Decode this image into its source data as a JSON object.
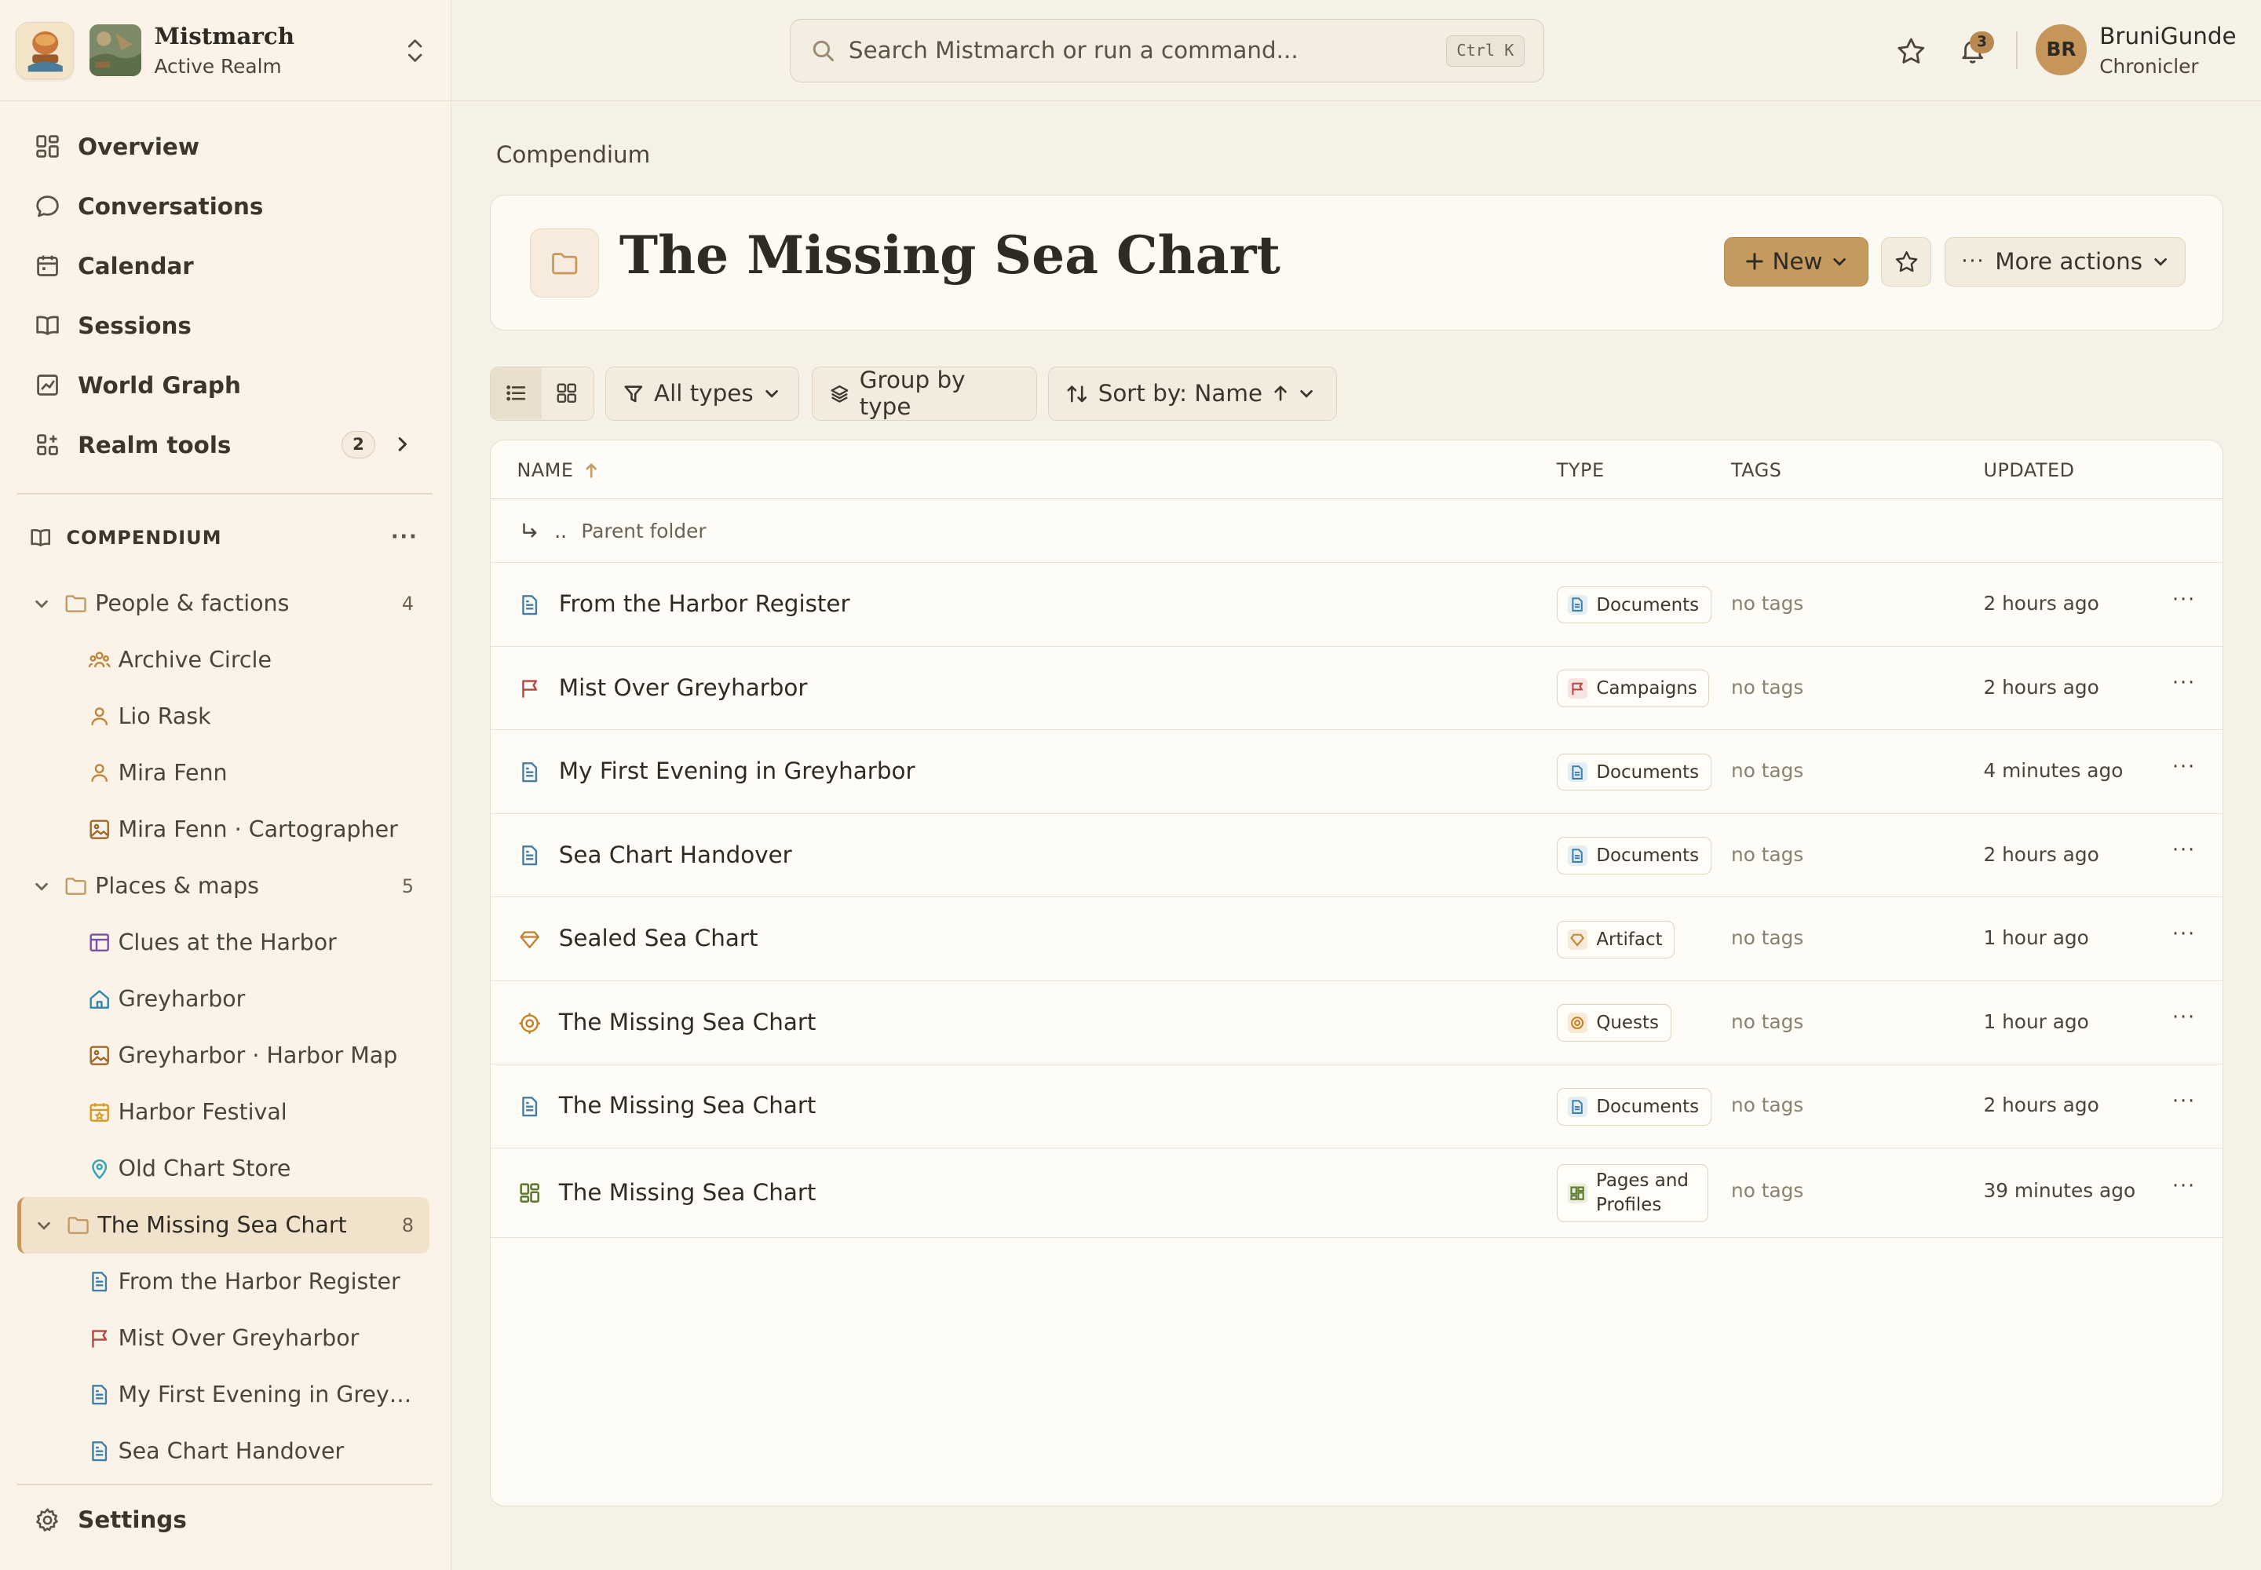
{
  "realm": {
    "name": "Mistmarch",
    "subtitle": "Active Realm"
  },
  "nav": {
    "overview": "Overview",
    "conversations": "Conversations",
    "calendar": "Calendar",
    "sessions": "Sessions",
    "world_graph": "World Graph",
    "realm_tools": "Realm tools",
    "realm_tools_badge": "2",
    "settings": "Settings"
  },
  "compendium": {
    "heading": "COMPENDIUM",
    "folders": [
      {
        "label": "People & factions",
        "count": "4",
        "items": [
          {
            "label": "Archive Circle",
            "icon": "group-icon"
          },
          {
            "label": "Lio Rask",
            "icon": "person-icon"
          },
          {
            "label": "Mira Fenn",
            "icon": "person-icon"
          },
          {
            "label": "Mira Fenn · Cartographer",
            "icon": "image-icon"
          }
        ]
      },
      {
        "label": "Places & maps",
        "count": "5",
        "items": [
          {
            "label": "Clues at the Harbor",
            "icon": "table-icon"
          },
          {
            "label": "Greyharbor",
            "icon": "home-icon"
          },
          {
            "label": "Greyharbor · Harbor Map",
            "icon": "image-icon"
          },
          {
            "label": "Harbor Festival",
            "icon": "calendar-star-icon"
          },
          {
            "label": "Old Chart Store",
            "icon": "map-pin-icon"
          }
        ]
      },
      {
        "label": "The Missing Sea Chart",
        "count": "8",
        "items": [
          {
            "label": "From the Harbor Register",
            "icon": "document-icon"
          },
          {
            "label": "Mist Over Greyharbor",
            "icon": "flag-icon"
          },
          {
            "label": "My First Evening in Grey…",
            "icon": "document-icon"
          },
          {
            "label": "Sea Chart Handover",
            "icon": "document-icon"
          }
        ]
      }
    ]
  },
  "topbar": {
    "search_placeholder": "Search Mistmarch or run a command...",
    "shortcut": "Ctrl K",
    "notification_count": "3",
    "user_initials": "BR",
    "user_name": "BruniGunde",
    "user_role": "Chronicler"
  },
  "page": {
    "breadcrumb": "Compendium",
    "title": "The Missing Sea Chart",
    "new_label": "New",
    "more_label": "More actions"
  },
  "toolbar": {
    "filter_label": "All types",
    "group_label": "Group by type",
    "sort_label": "Sort by: Name"
  },
  "table": {
    "headers": {
      "name": "NAME",
      "type": "TYPE",
      "tags": "TAGS",
      "updated": "UPDATED"
    },
    "parent_label": "Parent folder",
    "parent_dots": "..",
    "rows": [
      {
        "name": "From the Harbor Register",
        "icon": "document-icon",
        "type": "Documents",
        "tags": "no tags",
        "updated": "2 hours ago"
      },
      {
        "name": "Mist Over Greyharbor",
        "icon": "flag-icon",
        "type": "Campaigns",
        "tags": "no tags",
        "updated": "2 hours ago"
      },
      {
        "name": "My First Evening in Greyharbor",
        "icon": "document-icon",
        "type": "Documents",
        "tags": "no tags",
        "updated": "4 minutes ago"
      },
      {
        "name": "Sea Chart Handover",
        "icon": "document-icon",
        "type": "Documents",
        "tags": "no tags",
        "updated": "2 hours ago"
      },
      {
        "name": "Sealed Sea Chart",
        "icon": "gem-icon",
        "type": "Artifact",
        "tags": "no tags",
        "updated": "1 hour ago"
      },
      {
        "name": "The Missing Sea Chart",
        "icon": "target-icon",
        "type": "Quests",
        "tags": "no tags",
        "updated": "1 hour ago"
      },
      {
        "name": "The Missing Sea Chart",
        "icon": "document-icon",
        "type": "Documents",
        "tags": "no tags",
        "updated": "2 hours ago"
      },
      {
        "name": "The Missing Sea Chart",
        "icon": "grid-icon",
        "type": "Pages and Profiles",
        "tags": "no tags",
        "updated": "39 minutes ago"
      }
    ]
  },
  "colors": {
    "accent": "#c59a5f",
    "sidebar_bg": "#fbf3e8",
    "page_bg": "#f6f1e7",
    "documents": "#3f7fa8",
    "campaigns": "#b8433f",
    "artifact": "#c0843c",
    "quests": "#c77f22",
    "pages": "#5e7a2f"
  }
}
